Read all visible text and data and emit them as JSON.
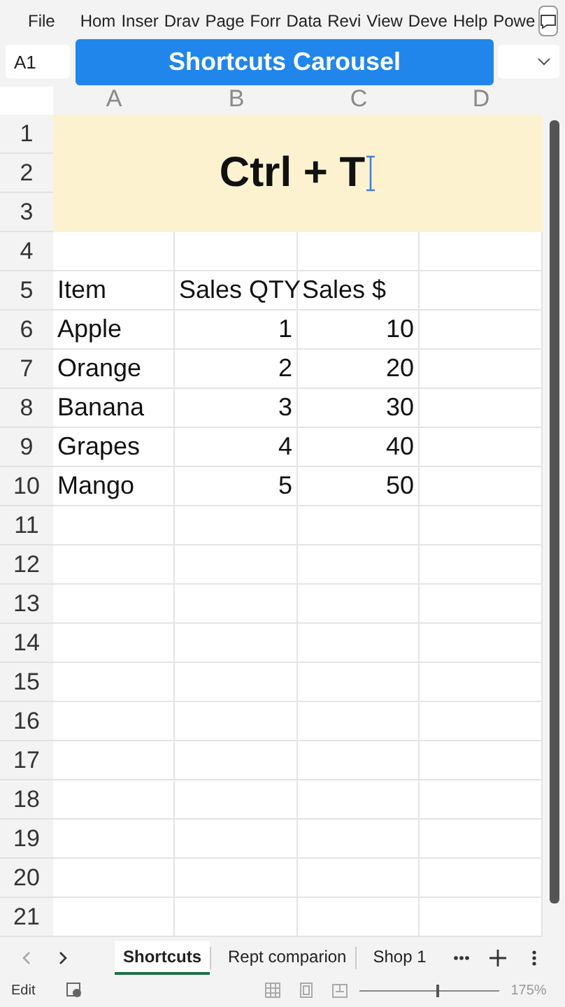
{
  "ribbon_tabs": [
    "File",
    "Hom",
    "Inser",
    "Drav",
    "Page",
    "Forr",
    "Data",
    "Revi",
    "View",
    "Deve",
    "Help",
    "Powe"
  ],
  "name_box": "A1",
  "banner": "Shortcuts Carousel",
  "grid": {
    "columns": [
      "A",
      "B",
      "C",
      "D"
    ],
    "row_numbers": [
      "1",
      "2",
      "3",
      "4",
      "5",
      "6",
      "7",
      "8",
      "9",
      "10",
      "11",
      "12",
      "13",
      "14",
      "15",
      "16",
      "17",
      "18",
      "19",
      "20",
      "21"
    ],
    "title": "Ctrl + T",
    "table_header": [
      "Item",
      "Sales QTY",
      "Sales $"
    ],
    "table_rows": [
      [
        "Apple",
        "1",
        "10"
      ],
      [
        "Orange",
        "2",
        "20"
      ],
      [
        "Banana",
        "3",
        "30"
      ],
      [
        "Grapes",
        "4",
        "40"
      ],
      [
        "Mango",
        "5",
        "50"
      ]
    ]
  },
  "sheet_tabs": [
    {
      "label": "Shortcuts",
      "selected": true
    },
    {
      "label": "Rept comparion",
      "selected": false
    },
    {
      "label": "Shop 1",
      "selected": false
    }
  ],
  "status_bar": {
    "mode": "Edit",
    "zoom": {
      "level": 0.55,
      "reading": "175%"
    }
  }
}
